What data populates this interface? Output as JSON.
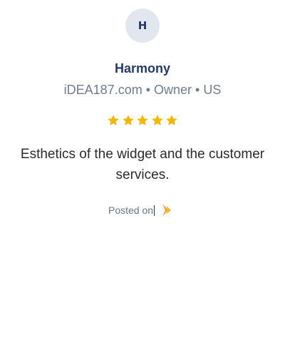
{
  "reviewer": {
    "initial": "H",
    "name": "Harmony",
    "meta": "iDEA187.com • Owner • US"
  },
  "rating": {
    "stars": 5,
    "max": 5,
    "star_color": "#f5b800"
  },
  "review": {
    "text": "Esthetics of the widget and the customer services."
  },
  "footer": {
    "posted_label": "Posted on",
    "source_icon": "capterra-logo-icon",
    "icon_colors": [
      "#ff9d28",
      "#f5b800"
    ]
  },
  "colors": {
    "name": "#233a6b",
    "meta": "#6f7d8f",
    "avatar_bg": "#e2e7ef"
  }
}
